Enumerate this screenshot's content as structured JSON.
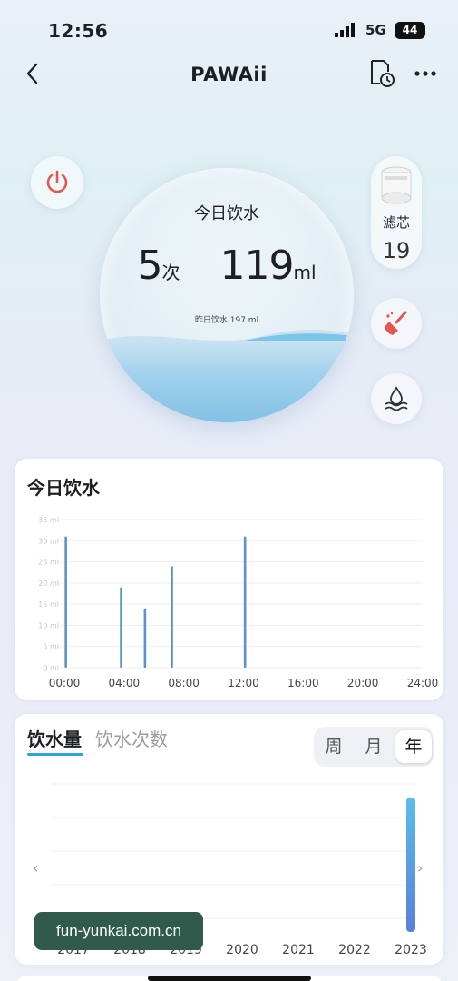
{
  "status_bar": {
    "time": "12:56",
    "network": "5G",
    "battery": "44"
  },
  "nav": {
    "title": "PAWAii"
  },
  "bowl": {
    "label": "今日饮水",
    "count": "5",
    "count_unit": "次",
    "volume": "119",
    "volume_unit": "ml",
    "yesterday": "昨日饮水 197 ml"
  },
  "filter": {
    "label": "滤芯",
    "value": "19"
  },
  "today_card": {
    "title": "今日饮水"
  },
  "today_chart": {
    "chart_data": {
      "type": "bar",
      "y_ticks": [
        "35 ml",
        "30 ml",
        "25 ml",
        "20 ml",
        "15 ml",
        "10 ml",
        "5 ml",
        "0 ml"
      ],
      "ylim": [
        0,
        35
      ],
      "x_ticks": [
        "00:00",
        "04:00",
        "08:00",
        "12:00",
        "16:00",
        "20:00",
        "24:00"
      ],
      "xlim": [
        0,
        24
      ],
      "x": [
        0.1,
        3.8,
        5.4,
        7.2,
        12.1
      ],
      "values": [
        31,
        19,
        14,
        24,
        31
      ],
      "color": "#5b93c4"
    }
  },
  "history_card": {
    "tab_active": "饮水量",
    "tab_inactive": "饮水次数",
    "segments": [
      "周",
      "月",
      "年"
    ],
    "selected_segment": "年",
    "chart_data": {
      "type": "bar",
      "categories": [
        "2017",
        "2018",
        "2019",
        "2020",
        "2021",
        "2022",
        "2023"
      ],
      "values": [
        0,
        0,
        0,
        0,
        0,
        0,
        1
      ],
      "color_top": "#5bbde8",
      "color_bottom": "#5b7fd8"
    }
  },
  "watermark": "fun-yunkai.com.cn",
  "colors": {
    "accent": "#2aa5d8",
    "power": "#e0584f"
  }
}
